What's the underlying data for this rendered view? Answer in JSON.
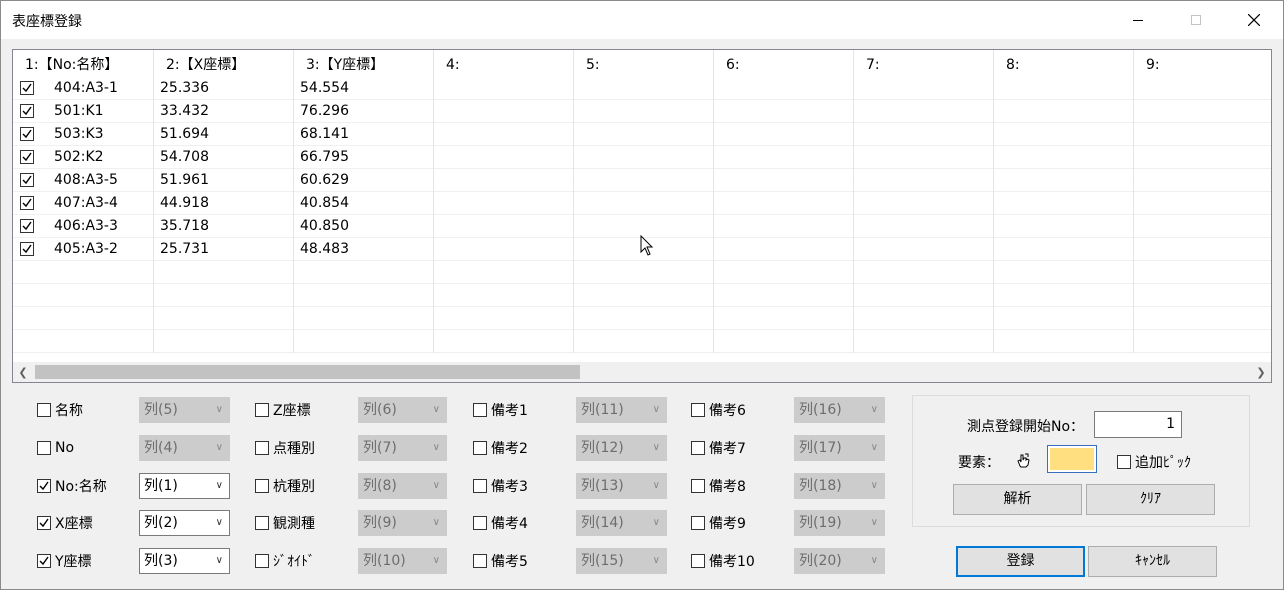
{
  "window": {
    "title": "表座標登録"
  },
  "grid": {
    "headers": [
      "1:【No:名称】",
      "2:【X座標】",
      "3:【Y座標】",
      "4:",
      "5:",
      "6:",
      "7:",
      "8:",
      "9:"
    ],
    "rows": [
      {
        "checked": true,
        "name": "404:A3-1",
        "x": "25.336",
        "y": "54.554"
      },
      {
        "checked": true,
        "name": "501:K1",
        "x": "33.432",
        "y": "76.296"
      },
      {
        "checked": true,
        "name": "503:K3",
        "x": "51.694",
        "y": "68.141"
      },
      {
        "checked": true,
        "name": "502:K2",
        "x": "54.708",
        "y": "66.795"
      },
      {
        "checked": true,
        "name": "408:A3-5",
        "x": "51.961",
        "y": "60.629"
      },
      {
        "checked": true,
        "name": "407:A3-4",
        "x": "44.918",
        "y": "40.854"
      },
      {
        "checked": true,
        "name": "406:A3-3",
        "x": "35.718",
        "y": "40.850"
      },
      {
        "checked": true,
        "name": "405:A3-2",
        "x": "25.731",
        "y": "48.483"
      }
    ]
  },
  "mapping": {
    "col1": [
      {
        "label": "名称",
        "checked": false,
        "value": "列(5)",
        "enabled": false
      },
      {
        "label": "No",
        "checked": false,
        "value": "列(4)",
        "enabled": false
      },
      {
        "label": "No:名称",
        "checked": true,
        "value": "列(1)",
        "enabled": true
      },
      {
        "label": "X座標",
        "checked": true,
        "value": "列(2)",
        "enabled": true
      },
      {
        "label": "Y座標",
        "checked": true,
        "value": "列(3)",
        "enabled": true
      }
    ],
    "col2": [
      {
        "label": "Z座標",
        "checked": false,
        "value": "列(6)",
        "enabled": false
      },
      {
        "label": "点種別",
        "checked": false,
        "value": "列(7)",
        "enabled": false
      },
      {
        "label": "杭種別",
        "checked": false,
        "value": "列(8)",
        "enabled": false
      },
      {
        "label": "観測種",
        "checked": false,
        "value": "列(9)",
        "enabled": false
      },
      {
        "label": "ｼﾞｵｲﾄﾞ",
        "checked": false,
        "value": "列(10)",
        "enabled": false
      }
    ],
    "col3": [
      {
        "label": "備考1",
        "checked": false,
        "value": "列(11)",
        "enabled": false
      },
      {
        "label": "備考2",
        "checked": false,
        "value": "列(12)",
        "enabled": false
      },
      {
        "label": "備考3",
        "checked": false,
        "value": "列(13)",
        "enabled": false
      },
      {
        "label": "備考4",
        "checked": false,
        "value": "列(14)",
        "enabled": false
      },
      {
        "label": "備考5",
        "checked": false,
        "value": "列(15)",
        "enabled": false
      }
    ],
    "col4": [
      {
        "label": "備考6",
        "checked": false,
        "value": "列(16)",
        "enabled": false
      },
      {
        "label": "備考7",
        "checked": false,
        "value": "列(17)",
        "enabled": false
      },
      {
        "label": "備考8",
        "checked": false,
        "value": "列(18)",
        "enabled": false
      },
      {
        "label": "備考9",
        "checked": false,
        "value": "列(19)",
        "enabled": false
      },
      {
        "label": "備考10",
        "checked": false,
        "value": "列(20)",
        "enabled": false
      }
    ]
  },
  "register": {
    "start_no_label": "測点登録開始No：",
    "start_no_value": "1",
    "element_label": "要素：",
    "element_color": "#ffdf80",
    "add_pick_label": "追加ﾋﾟｯｸ",
    "add_pick_checked": false,
    "analyze_label": "解析",
    "clear_label": "ｸﾘｱ",
    "register_label": "登録",
    "cancel_label": "ｷｬﾝｾﾙ"
  }
}
